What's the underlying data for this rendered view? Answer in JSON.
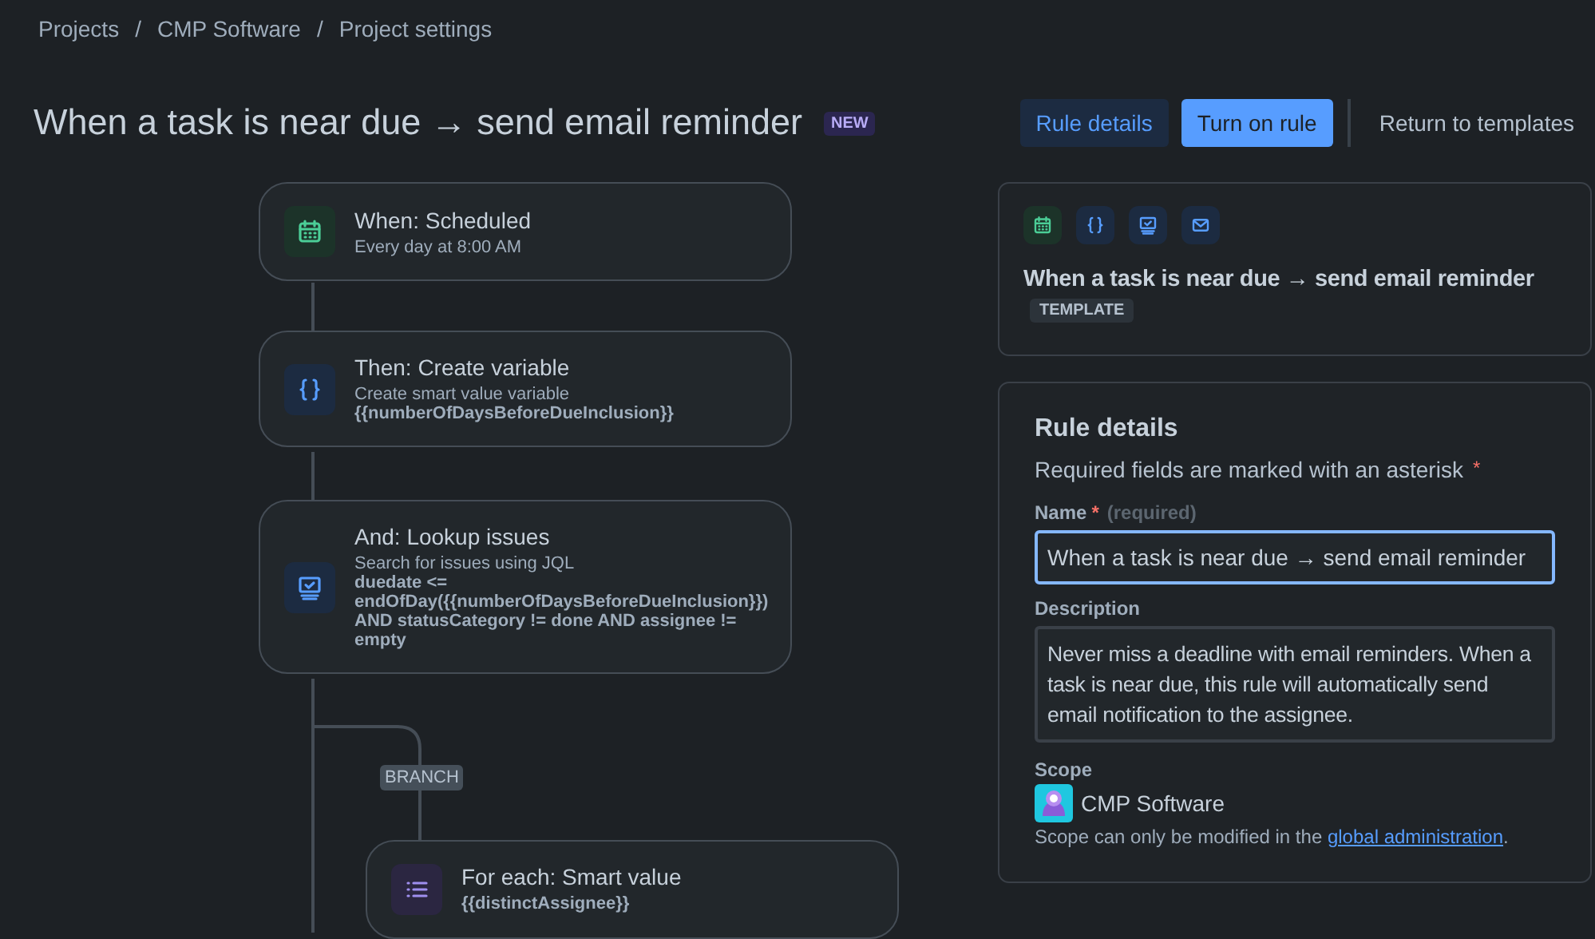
{
  "breadcrumbs": [
    "Projects",
    "CMP Software",
    "Project settings"
  ],
  "breadcrumb_separator": "/",
  "title": "When a task is near due → send email reminder",
  "title_badge": "NEW",
  "actions": [
    {
      "label": "Rule details",
      "kind": "secondary"
    },
    {
      "label": "Turn on rule",
      "kind": "primary"
    },
    {
      "label": "Return to templates",
      "kind": "subtle"
    }
  ],
  "flow": {
    "nodes": [
      {
        "kind": "calendar",
        "title": "When: Scheduled",
        "description": "Every day at 8:00 AM"
      },
      {
        "kind": "braces",
        "title": "Then: Create variable",
        "description": "Create smart value variable",
        "detail": "{{numberOfDaysBeforeDueInclusion}}"
      },
      {
        "kind": "monitor",
        "title": "And: Lookup issues",
        "description": "Search for issues using JQL",
        "detail": "duedate <= endOfDay({{numberOfDaysBeforeDueInclusion}}) AND statusCategory != done AND assignee != empty"
      }
    ],
    "branch_label": "BRANCH",
    "branch_node": {
      "kind": "list",
      "title": "For each: Smart value",
      "detail": "{{distinctAssignee}}"
    }
  },
  "template_card": {
    "icons": [
      {
        "kind": "calendar"
      },
      {
        "kind": "braces"
      },
      {
        "kind": "monitor"
      },
      {
        "kind": "mail"
      }
    ],
    "title": "When a task is near due → send email reminder",
    "badge": "TEMPLATE"
  },
  "rule_details": {
    "heading": "Rule details",
    "required_note": "Required fields are marked with an asterisk",
    "required_mark": "*",
    "name_label": "Name",
    "name_hint": "(required)",
    "name_value": "When a task is near due → send email reminder",
    "name_focused": true,
    "description_label": "Description",
    "description_value": "Never miss a deadline with email reminders. When a task is near due, this rule will automatically send email notification to the assignee.",
    "scope_label": "Scope",
    "scope_value": "CMP Software",
    "scope_note": "Scope can only be modified in the ",
    "scope_link": "global administration",
    "scope_note_end": "."
  }
}
